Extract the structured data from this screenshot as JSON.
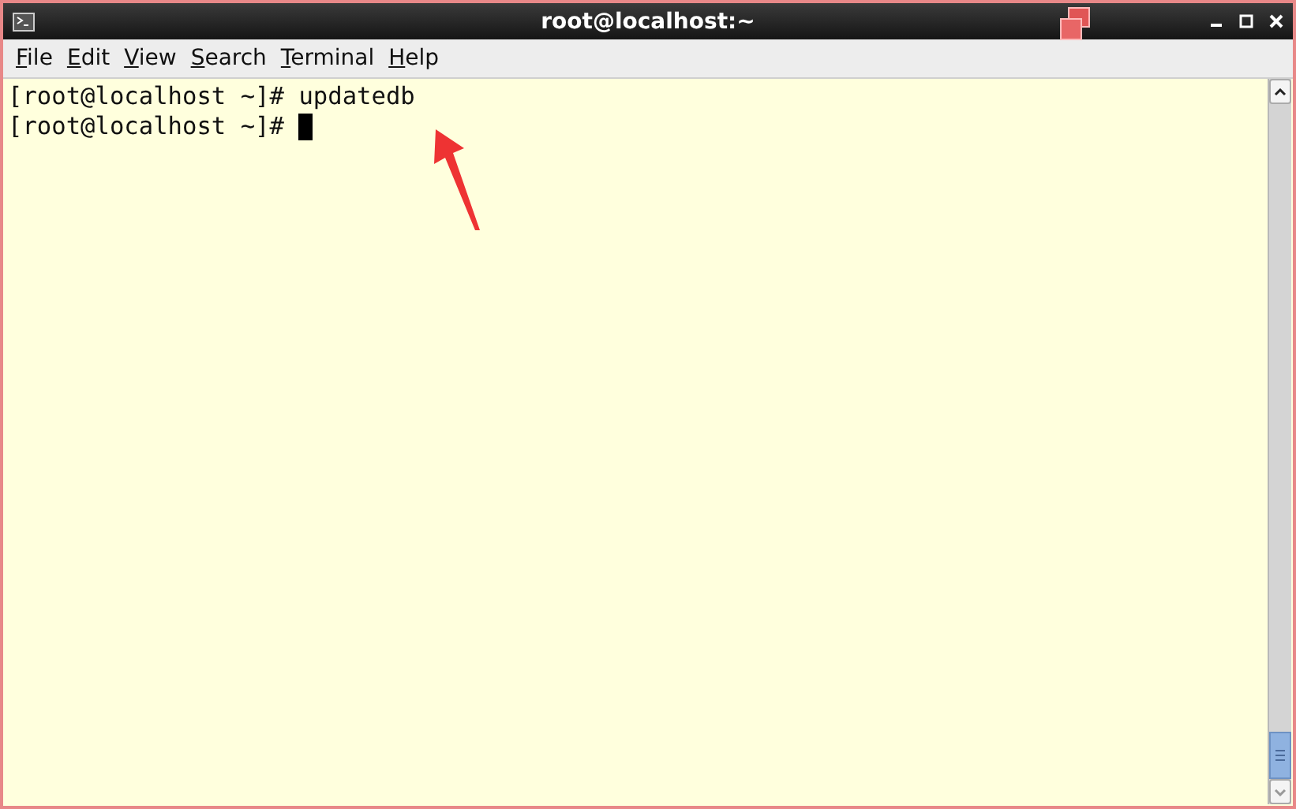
{
  "window": {
    "title": "root@localhost:~"
  },
  "menu": [
    {
      "label": "File"
    },
    {
      "label": "Edit"
    },
    {
      "label": "View"
    },
    {
      "label": "Search"
    },
    {
      "label": "Terminal"
    },
    {
      "label": "Help"
    }
  ],
  "terminal": {
    "lines": [
      {
        "text": "[root@localhost ~]# updatedb",
        "cursor": false
      },
      {
        "text": "[root@localhost ~]# ",
        "cursor": true
      }
    ]
  }
}
